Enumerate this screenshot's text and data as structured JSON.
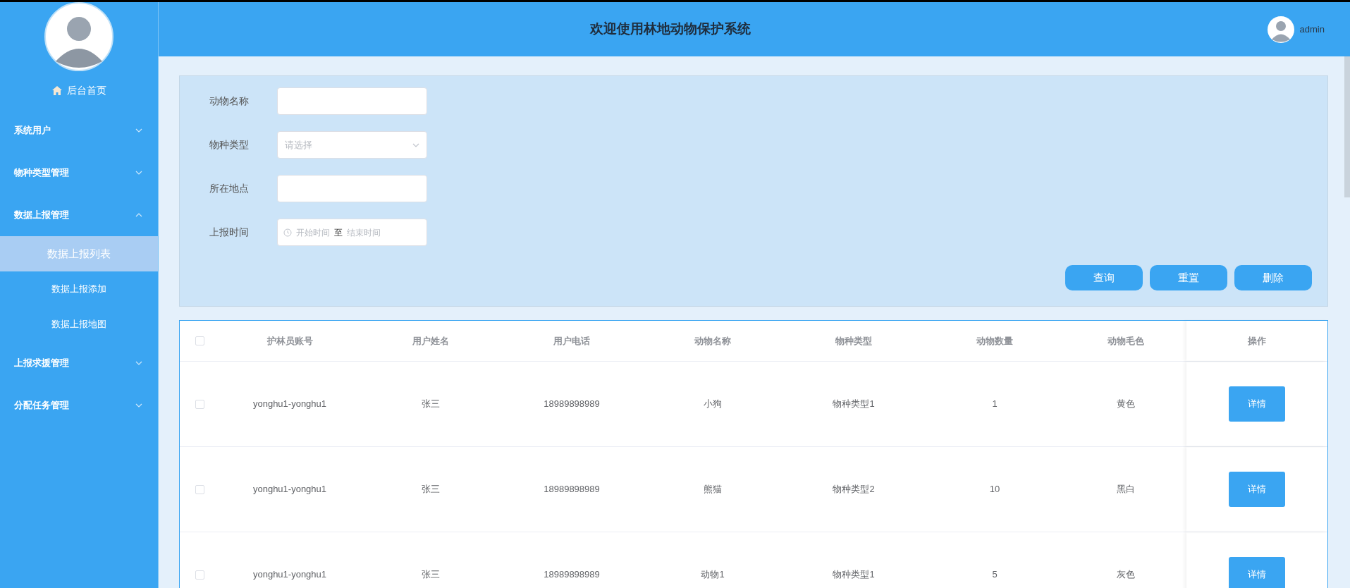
{
  "header": {
    "title": "欢迎使用林地动物保护系统",
    "user": "admin"
  },
  "sidebar": {
    "home": "后台首页",
    "menus": [
      {
        "label": "系统用户",
        "expanded": false
      },
      {
        "label": "物种类型管理",
        "expanded": false
      },
      {
        "label": "数据上报管理",
        "expanded": true,
        "children": [
          {
            "label": "数据上报列表",
            "selected": true
          },
          {
            "label": "数据上报添加",
            "selected": false
          },
          {
            "label": "数据上报地图",
            "selected": false
          }
        ]
      },
      {
        "label": "上报求援管理",
        "expanded": false
      },
      {
        "label": "分配任务管理",
        "expanded": false
      }
    ]
  },
  "search_form": {
    "fields": [
      {
        "kind": "text",
        "label": "动物名称"
      },
      {
        "kind": "select",
        "label": "物种类型",
        "placeholder": "请选择"
      },
      {
        "kind": "text",
        "label": "所在地点"
      },
      {
        "kind": "daterange",
        "label": "上报时间",
        "start_placeholder": "开始时间",
        "separator": "至",
        "end_placeholder": "结束时间"
      }
    ],
    "buttons": [
      "查询",
      "重置",
      "删除"
    ]
  },
  "table": {
    "header_checked": false,
    "columns": [
      "护林员账号",
      "用户姓名",
      "用户电话",
      "动物名称",
      "物种类型",
      "动物数量",
      "动物毛色",
      "操作"
    ],
    "rows": [
      {
        "checked": false,
        "cells": [
          "yonghu1-yonghu1",
          "张三",
          "18989898989",
          "小狗",
          "物种类型1",
          "1",
          "黄色"
        ],
        "action": "详情"
      },
      {
        "checked": false,
        "cells": [
          "yonghu1-yonghu1",
          "张三",
          "18989898989",
          "熊猫",
          "物种类型2",
          "10",
          "黑白"
        ],
        "action": "详情"
      },
      {
        "checked": false,
        "cells": [
          "yonghu1-yonghu1",
          "张三",
          "18989898989",
          "动物1",
          "物种类型1",
          "5",
          "灰色"
        ],
        "action": "详情"
      }
    ]
  }
}
